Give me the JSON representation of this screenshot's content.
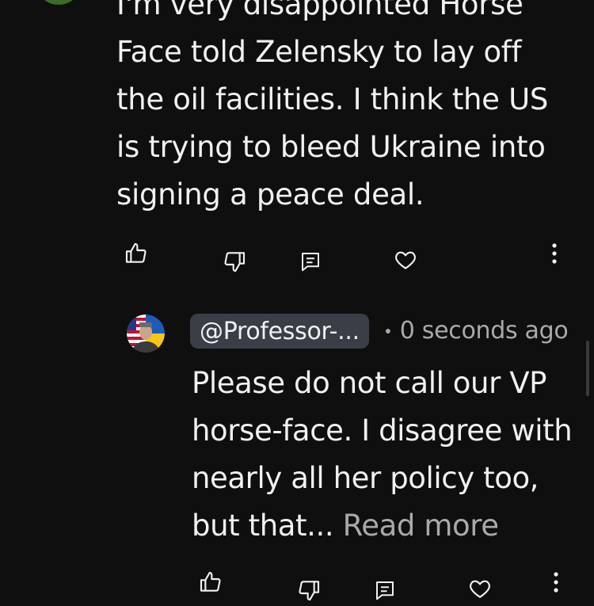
{
  "comment": {
    "text": "I'm very disappointed Horse\nFace told Zelensky to lay off\nthe oil facilities. I think the US\nis trying to bleed Ukraine into\nsigning a peace deal.",
    "actions": {
      "like": "thumbs-up-icon",
      "dislike": "thumbs-down-icon",
      "reply": "reply-icon",
      "heart": "heart-icon",
      "more": "more-vertical-icon"
    }
  },
  "reply": {
    "handle": "@Professor-...",
    "separator": "•",
    "time": "0 seconds ago",
    "text": "Please do not call our VP horse-face. I disagree with nearly all her policy too, but that...",
    "read_more": "Read more",
    "actions": {
      "like": "thumbs-up-icon",
      "dislike": "thumbs-down-icon",
      "reply": "reply-icon",
      "heart": "heart-icon",
      "more": "more-vertical-icon"
    }
  },
  "colors": {
    "background": "#0f0f0f",
    "text": "#f1f1f1",
    "secondary_text": "#aaaaaa",
    "chip": "#3a3f47"
  }
}
